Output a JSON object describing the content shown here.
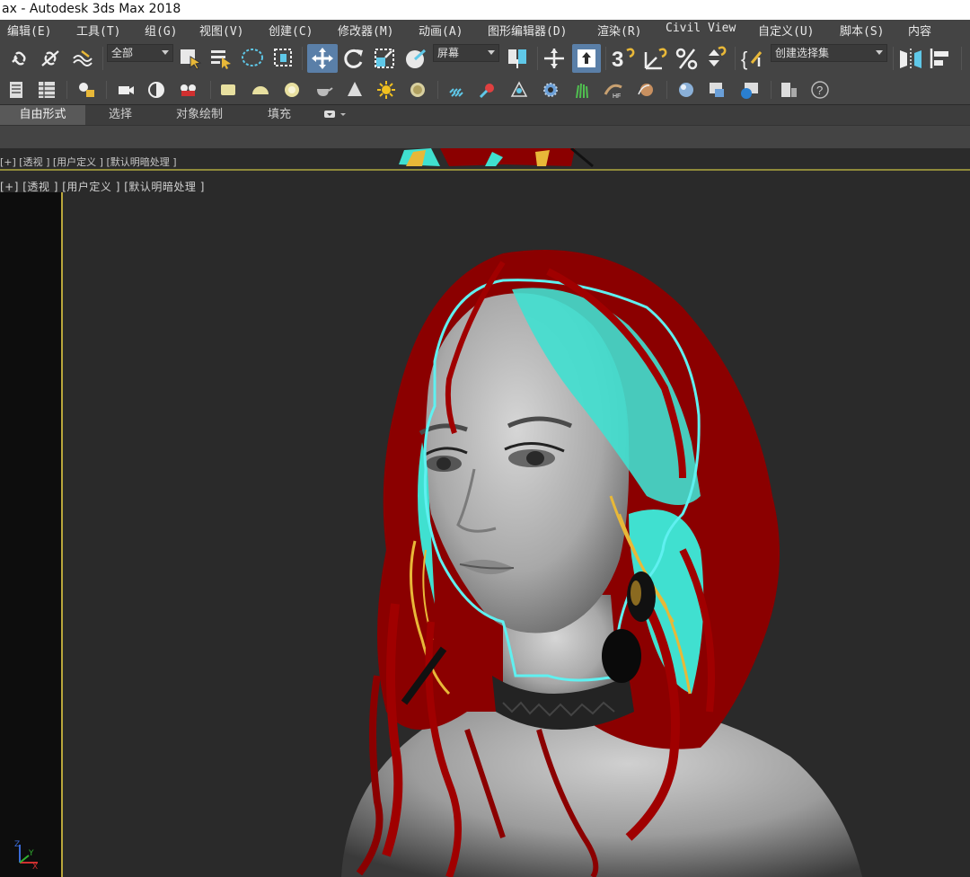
{
  "window": {
    "title": "ax - Autodesk 3ds Max 2018"
  },
  "menu": {
    "items": [
      "编辑(E)",
      "工具(T)",
      "组(G)",
      "视图(V)",
      "创建(C)",
      "修改器(M)",
      "动画(A)",
      "图形编辑器(D)",
      "渲染(R)",
      "Civil View",
      "自定义(U)",
      "脚本(S)",
      "内容"
    ]
  },
  "toolbar": {
    "selection_filter": "全部",
    "reference_coord": "屏幕",
    "named_selection_placeholder": "创建选择集",
    "snap_angle_label": "3",
    "percent_snap_label": "%"
  },
  "ribbon": {
    "tabs": [
      "自由形式",
      "选择",
      "对象绘制",
      "填充"
    ],
    "active_tab": "自由形式"
  },
  "viewport_top": {
    "label": "[+] [透视 ] [用户定义 ] [默认明暗处理 ]"
  },
  "viewport_main": {
    "label": "[+] [透视 ] [用户定义 ] [默认明暗处理 ]",
    "axis_labels": [
      "Z",
      "X",
      "Y"
    ],
    "border_color": "#b9a63c",
    "hair_color": "#8b0000",
    "selection_color": "#40e0d0",
    "guide_color": "#e8b838"
  }
}
